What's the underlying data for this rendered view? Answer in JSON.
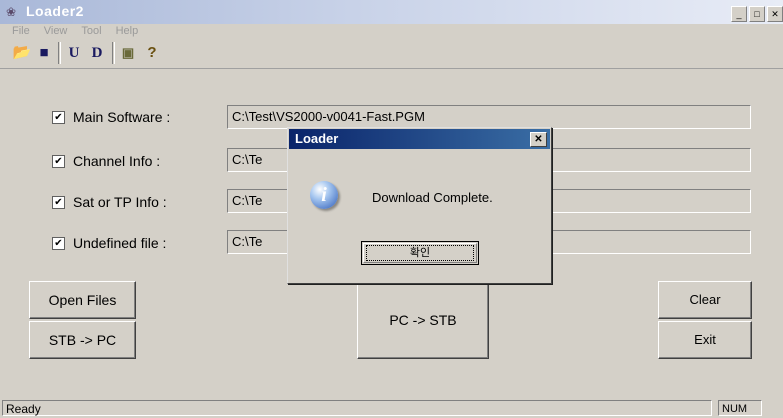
{
  "window": {
    "title": "Loader2",
    "icon": "app-icon"
  },
  "menu": [
    "File",
    "View",
    "Tool",
    "Help"
  ],
  "toolbar": {
    "open": "open-folder-icon",
    "save": "save-disk-icon",
    "u_label": "U",
    "d_label": "D",
    "image": "image-icon",
    "help": "help-icon"
  },
  "files": [
    {
      "label": "Main Software :",
      "checked": true,
      "path": "C:\\Test\\VS2000-v0041-Fast.PGM"
    },
    {
      "label": "Channel Info :",
      "checked": true,
      "path": "C:\\Te"
    },
    {
      "label": "Sat or TP Info :",
      "checked": true,
      "path": "C:\\Te"
    },
    {
      "label": "Undefined file :",
      "checked": true,
      "path": "C:\\Te"
    }
  ],
  "buttons": {
    "open_files": "Open Files",
    "stb_to_pc": "STB -> PC",
    "pc_to_stb": "PC -> STB",
    "clear": "Clear",
    "exit": "Exit"
  },
  "status": {
    "text": "Ready",
    "num": "NUM"
  },
  "dialog": {
    "title": "Loader",
    "message": "Download Complete.",
    "ok": "확인",
    "icon": "info-icon"
  }
}
